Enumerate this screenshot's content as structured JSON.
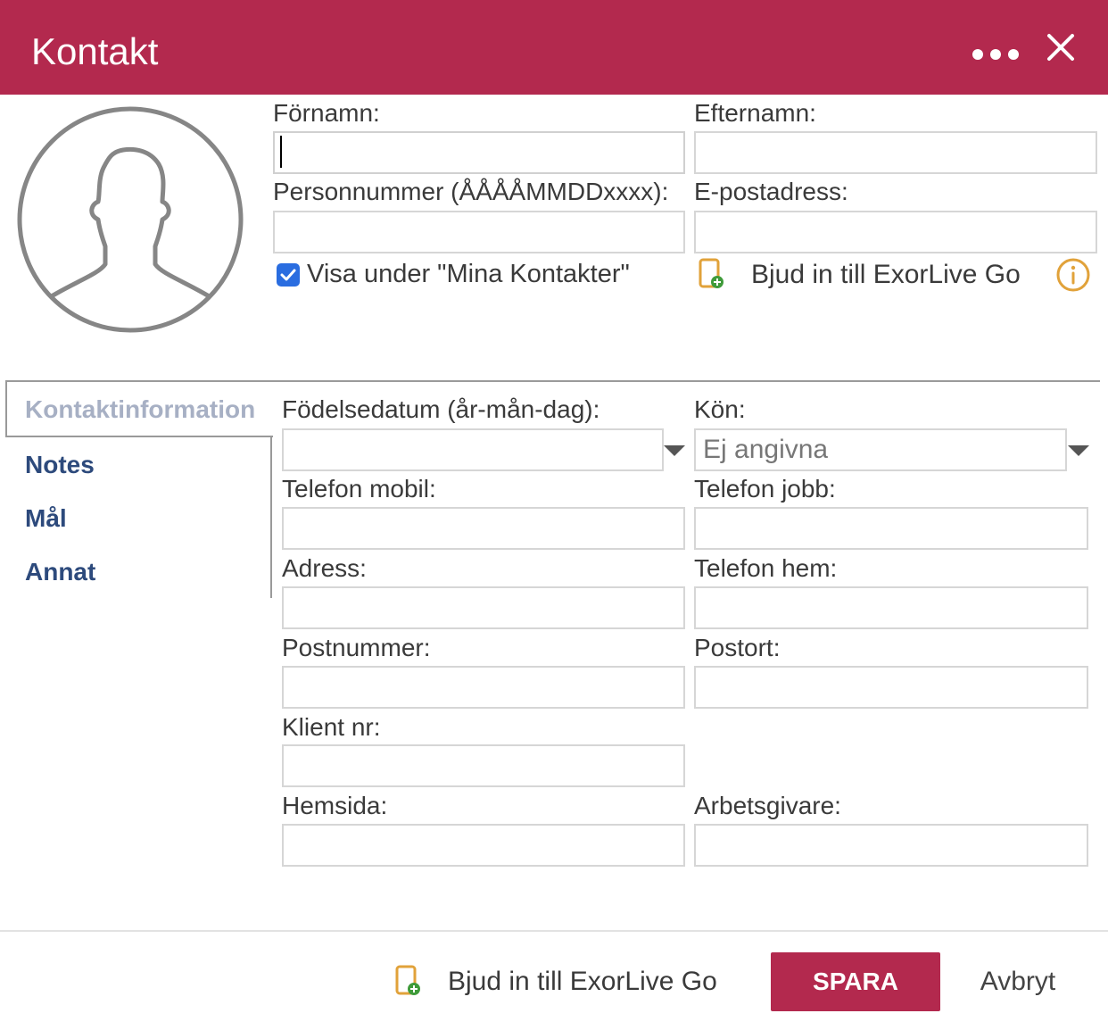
{
  "header": {
    "title": "Kontakt",
    "more_icon": "more-horizontal-icon",
    "close_icon": "close-icon",
    "color": "#b3294e"
  },
  "top_form": {
    "first_name_label": "Förnamn:",
    "first_name_value": "",
    "last_name_label": "Efternamn:",
    "last_name_value": "",
    "ssn_label": "Personnummer (ÅÅÅÅMMDDxxxx):",
    "ssn_value": "",
    "email_label": "E-postadress:",
    "email_value": "",
    "show_in_contacts_label": "Visa under \"Mina Kontakter\"",
    "show_in_contacts_checked": true,
    "invite_label": "Bjud in till ExorLive Go",
    "invite_icon": "device-add-icon",
    "info_icon": "info-icon"
  },
  "tabs": {
    "active": "Kontaktinformation",
    "items": [
      "Kontaktinformation",
      "Notes",
      "Mål",
      "Annat"
    ]
  },
  "contact_form": {
    "birthdate_label": "Födelsedatum (år-mån-dag):",
    "birthdate_value": "",
    "gender_label": "Kön:",
    "gender_value": "Ej angivna",
    "mobile_label": "Telefon mobil:",
    "mobile_value": "",
    "work_phone_label": "Telefon jobb:",
    "work_phone_value": "",
    "address_label": "Adress:",
    "address_value": "",
    "home_phone_label": "Telefon hem:",
    "home_phone_value": "",
    "postal_code_label": "Postnummer:",
    "postal_code_value": "",
    "city_label": "Postort:",
    "city_value": "",
    "client_no_label": "Klient nr:",
    "client_no_value": "",
    "website_label": "Hemsida:",
    "website_value": "",
    "employer_label": "Arbetsgivare:",
    "employer_value": ""
  },
  "footer": {
    "invite_label": "Bjud in till ExorLive Go",
    "save_label": "SPARA",
    "cancel_label": "Avbryt"
  }
}
